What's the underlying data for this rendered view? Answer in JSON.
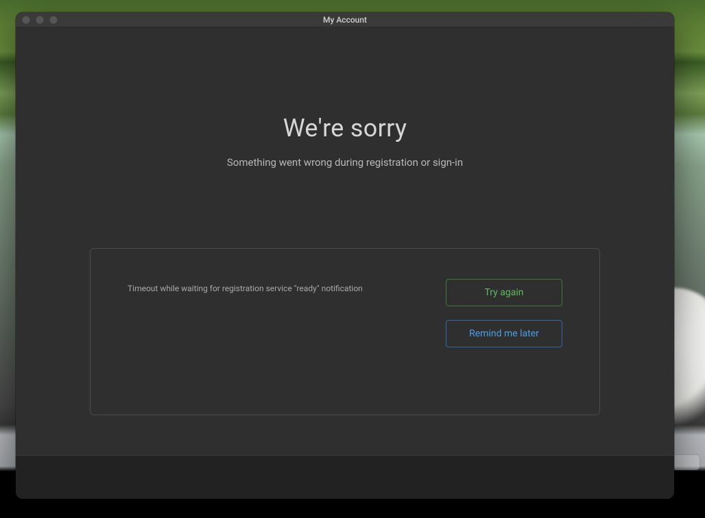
{
  "window": {
    "title": "My Account"
  },
  "page": {
    "heading": "We're sorry",
    "subheading": "Something went wrong during registration or sign-in"
  },
  "panel": {
    "message": "Timeout while waiting for registration service \"ready\" notification",
    "actions": {
      "try_again_label": "Try again",
      "remind_later_label": "Remind me later"
    }
  },
  "colors": {
    "accent_green": "#5dbb5d",
    "accent_blue": "#4b9fe8",
    "window_bg": "#2f2f2f",
    "footer_bg": "#222222"
  }
}
